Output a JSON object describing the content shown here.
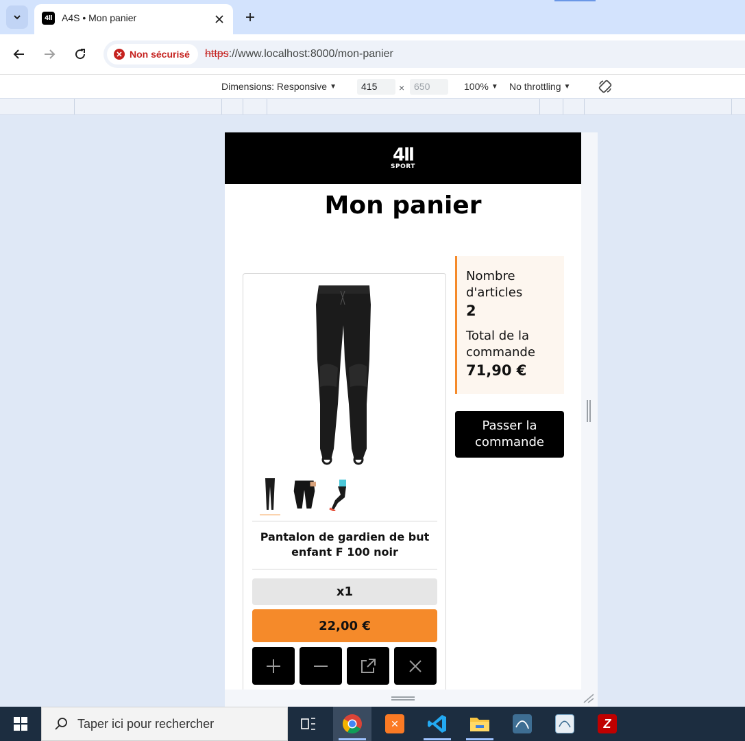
{
  "browser": {
    "tab": {
      "favicon_text": "4ll",
      "title": "A4S • Mon panier"
    },
    "security_label": "Non sécurisé",
    "url_scheme": "https",
    "url_rest": "://www.localhost:8000/mon-panier"
  },
  "devtools": {
    "dimensions_label": "Dimensions: Responsive",
    "width": "415",
    "height": "650",
    "times": "×",
    "zoom": "100%",
    "throttling": "No throttling"
  },
  "site": {
    "logo_mark": "4ll",
    "logo_sub": "SPORT",
    "page_title": "Mon panier",
    "product": {
      "name": "Pantalon de gardien de but enfant F 100 noir",
      "quantity": "x1",
      "price": "22,00 €"
    },
    "summary": {
      "items_label": "Nombre d'articles",
      "items_value": "2",
      "total_label": "Total de la commande",
      "total_value": "71,90 €"
    },
    "checkout_label": "Passer la commande"
  },
  "taskbar": {
    "search_placeholder": "Taper ici pour rechercher",
    "apps": [
      "task-view",
      "chrome",
      "xampp",
      "vscode",
      "file-explorer",
      "mysql-workbench",
      "mysql-installer",
      "filezilla"
    ]
  },
  "colors": {
    "accent": "#f58a2a",
    "header_bg": "#000000",
    "summary_bg": "#fdf6ef",
    "chrome_tabstrip": "#d3e3fd",
    "insecure_red": "#c5221f",
    "taskbar_bg": "#1c2d40"
  }
}
